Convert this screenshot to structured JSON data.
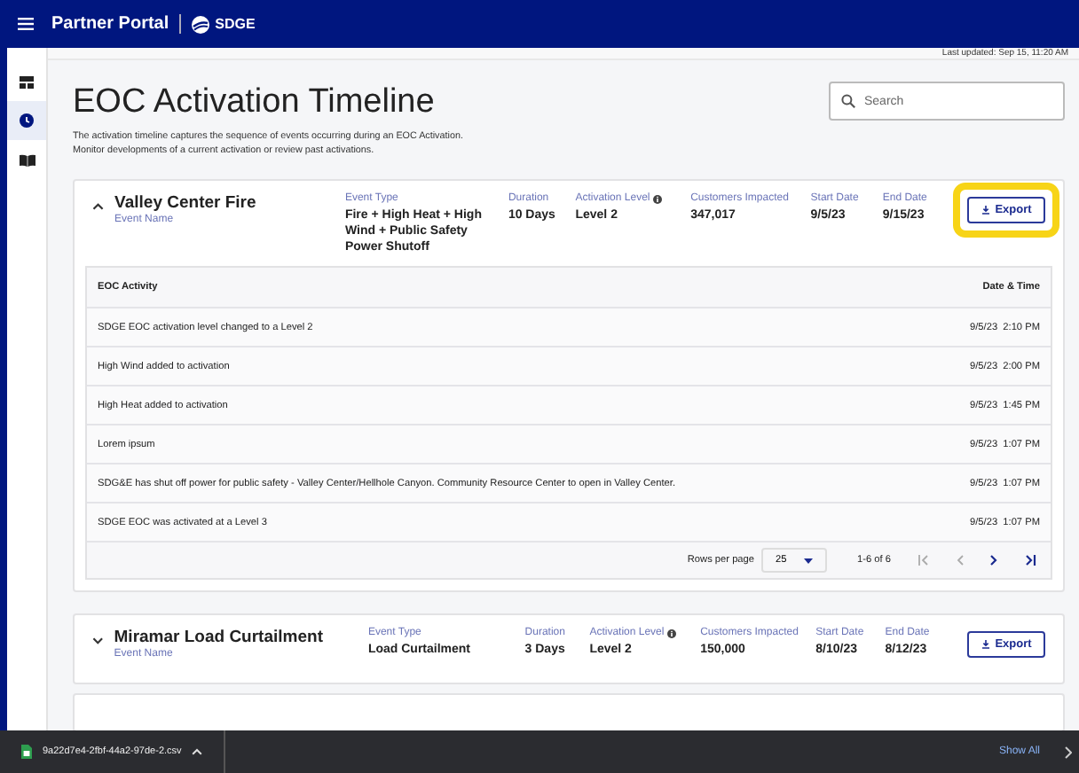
{
  "header": {
    "title": "Partner Portal",
    "brand": "SDGE"
  },
  "sidebar": {
    "items": [
      {
        "selected": false
      },
      {
        "selected": true
      },
      {
        "selected": false
      }
    ]
  },
  "last_updated": "Last updated: Sep 15, 11:20 AM",
  "page": {
    "title": "EOC Activation Timeline",
    "search": {
      "placeholder": "Search"
    },
    "description": [
      "The activation timeline captures the sequence of events occurring during an EOC Activation.",
      "Monitor developments of a current activation or review past activations."
    ]
  },
  "events": [
    {
      "name": "Valley Center Fire",
      "name_label": "Event Name",
      "expanded": true,
      "highlighted": true,
      "export": "Export",
      "fields": [
        {
          "label": "Event Type",
          "value": "Fire + High Heat + High Wind + Public Safety Power Shutoff",
          "info": false
        },
        {
          "label": "Duration",
          "value": "10 Days",
          "info": false
        },
        {
          "label": "Activation Level",
          "value": "Level 2",
          "info": true
        },
        {
          "label": "Customers Impacted",
          "value": "347,017",
          "info": false
        },
        {
          "label": "Start Date",
          "value": "9/5/23",
          "info": false
        },
        {
          "label": "End Date",
          "value": "9/15/23",
          "info": false
        }
      ],
      "table": {
        "columns": [
          "EOC Activity",
          "Date & Time"
        ],
        "rows": [
          {
            "activity": "SDGE EOC activation level changed to a Level 2",
            "date": "9/5/23",
            "time": "2:10 PM"
          },
          {
            "activity": "High Wind added to activation",
            "date": "9/5/23",
            "time": "2:00 PM"
          },
          {
            "activity": "High Heat added to activation",
            "date": "9/5/23",
            "time": "1:45 PM"
          },
          {
            "activity": "Lorem ipsum",
            "date": "9/5/23",
            "time": "1:07 PM"
          },
          {
            "activity": "SDG&E has shut off power for public safety - Valley Center/Hellhole Canyon. Community Resource Center to open in Valley Center.",
            "date": "9/5/23",
            "time": "1:07 PM"
          },
          {
            "activity": "SDGE EOC was activated at a Level 3",
            "date": "9/5/23",
            "time": "1:07 PM"
          }
        ],
        "pagination": {
          "rows_label": "Rows per page",
          "rows_value": "25",
          "range": "1-6 of 6"
        }
      }
    },
    {
      "name": "Miramar Load Curtailment",
      "name_label": "Event Name",
      "expanded": false,
      "highlighted": false,
      "export": "Export",
      "fields": [
        {
          "label": "Event Type",
          "value": "Load Curtailment",
          "info": false
        },
        {
          "label": "Duration",
          "value": "3 Days",
          "info": false
        },
        {
          "label": "Activation Level",
          "value": "Level 2",
          "info": true
        },
        {
          "label": "Customers Impacted",
          "value": "150,000",
          "info": false
        },
        {
          "label": "Start Date",
          "value": "8/10/23",
          "info": false
        },
        {
          "label": "End Date",
          "value": "8/12/23",
          "info": false
        }
      ]
    }
  ],
  "download_bar": {
    "file": "9a22d7e4-2fbf-44a2-97de-2.csv",
    "show_all": "Show All"
  }
}
